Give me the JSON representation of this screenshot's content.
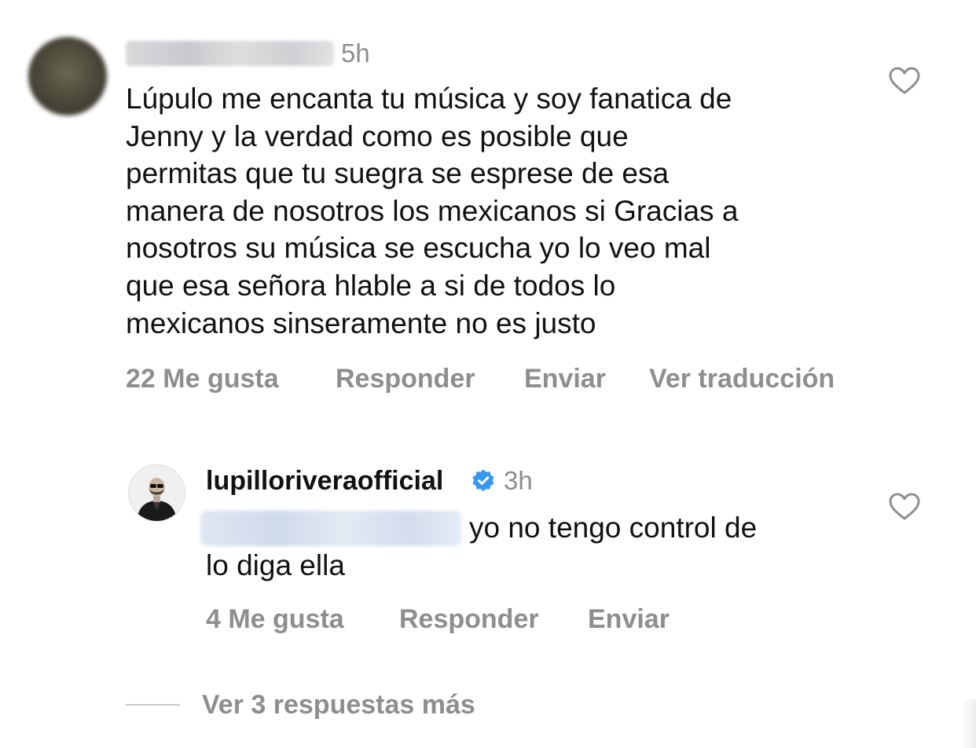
{
  "comment": {
    "time": "5h",
    "text": "Lúpulo me encanta tu música y soy fanatica de\nJenny y la verdad como es posible que\npermitas que tu suegra se esprese de esa\nmanera de nosotros los mexicanos si Gracias a\nnosotros su música se escucha yo lo veo mal\nque esa señora hlable a si de todos lo\nmexicanos sinseramente no es justo",
    "likes": "22 Me gusta",
    "reply_label": "Responder",
    "send_label": "Enviar",
    "translate_label": "Ver traducción"
  },
  "reply": {
    "username": "lupilloriveraofficial",
    "time": "3h",
    "text_line1": "yo no tengo control de",
    "text_line2": "lo diga ella",
    "likes": "4 Me gusta",
    "reply_label": "Responder",
    "send_label": "Enviar"
  },
  "view_more_label": "Ver 3 respuestas más",
  "colors": {
    "text": "#111111",
    "secondary": "#8e8e8e",
    "verified": "#3897f0",
    "divider": "#c7c7c7"
  },
  "icons": {
    "like": "heart-outline-icon",
    "verified": "verified-badge-icon"
  }
}
